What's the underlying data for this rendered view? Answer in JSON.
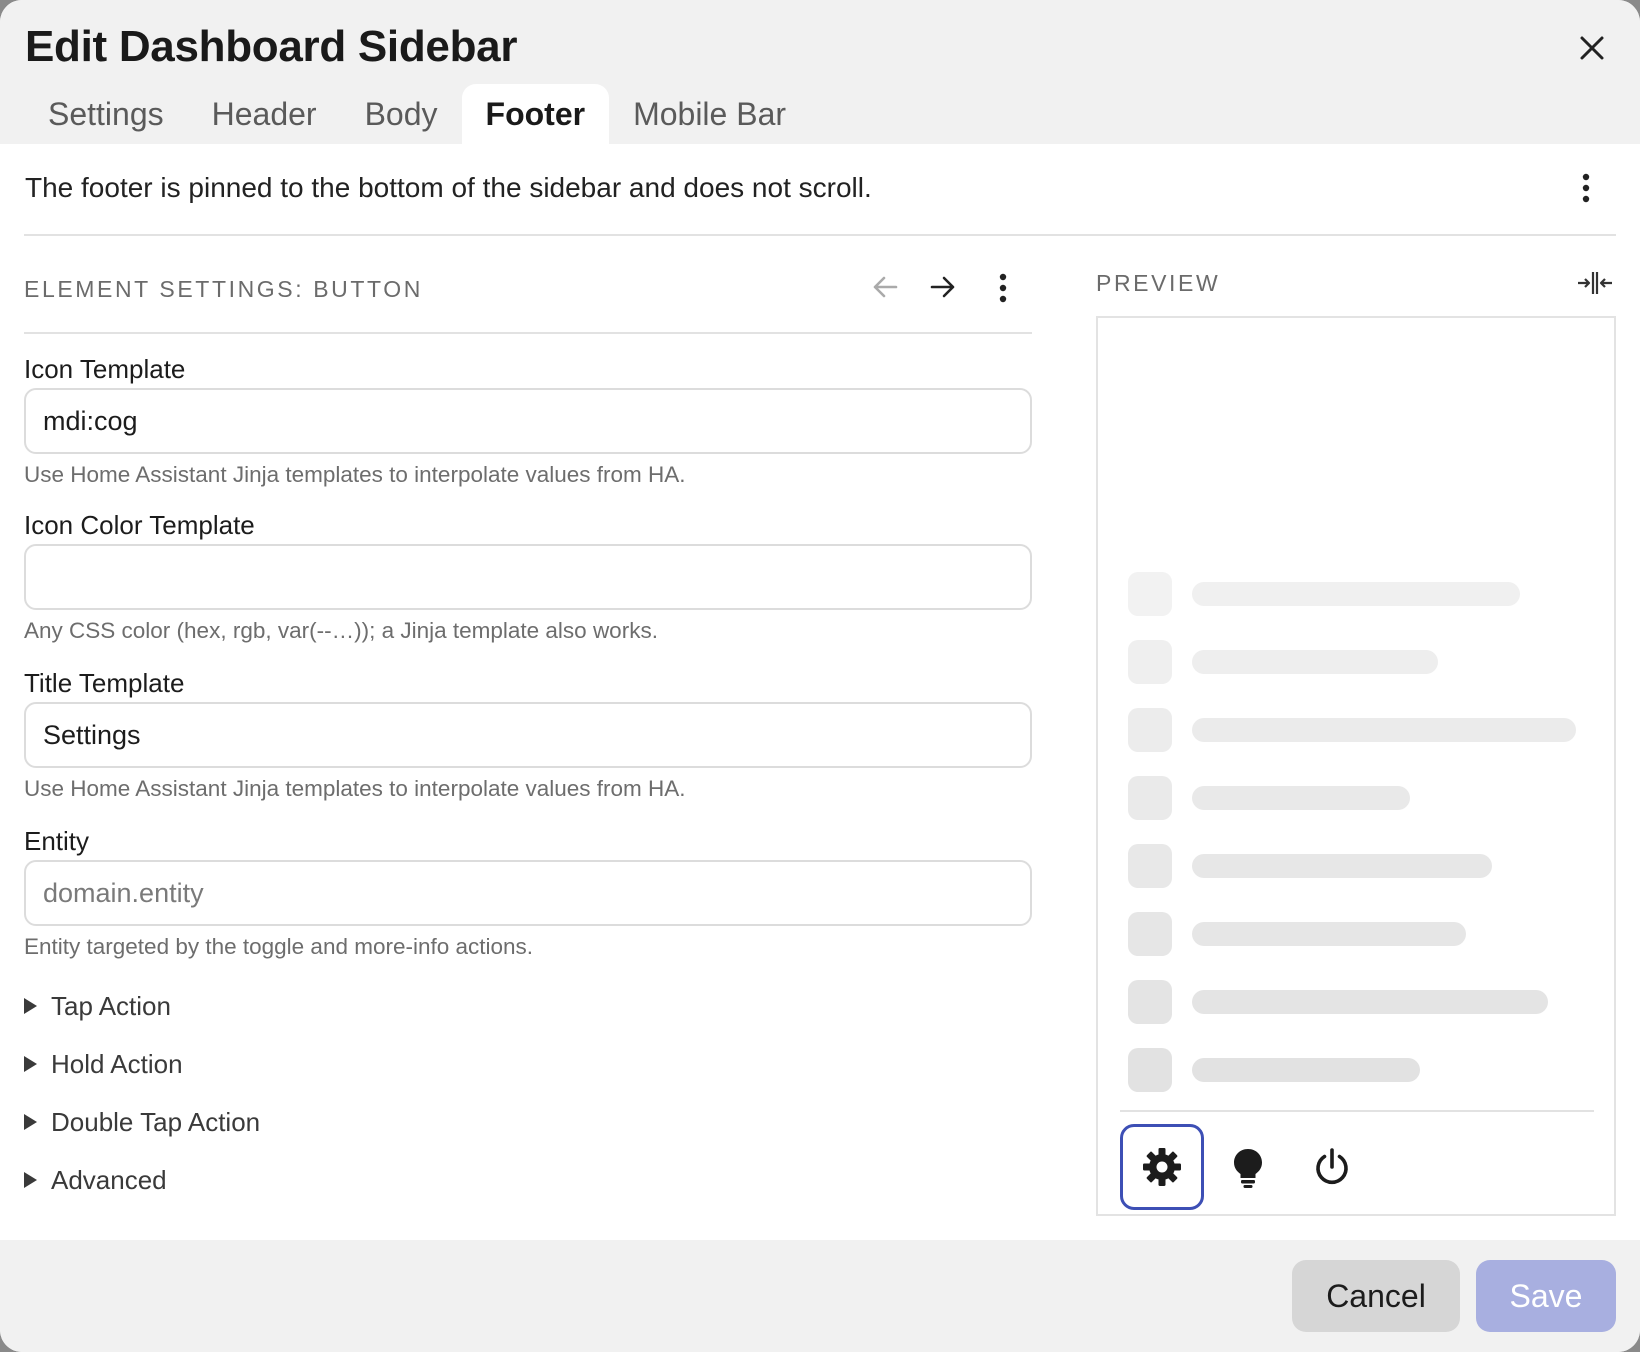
{
  "dialog": {
    "title": "Edit Dashboard Sidebar",
    "tabs": [
      {
        "label": "Settings",
        "active": false
      },
      {
        "label": "Header",
        "active": false
      },
      {
        "label": "Body",
        "active": false
      },
      {
        "label": "Footer",
        "active": true
      },
      {
        "label": "Mobile Bar",
        "active": false
      }
    ],
    "description": "The footer is pinned to the bottom of the sidebar and does not scroll."
  },
  "element_settings": {
    "title": "ELEMENT SETTINGS: BUTTON",
    "fields": {
      "icon_template": {
        "label": "Icon Template",
        "value": "mdi:cog",
        "helper": "Use Home Assistant Jinja templates to interpolate values from HA."
      },
      "icon_color_template": {
        "label": "Icon Color Template",
        "value": "",
        "helper": "Any CSS color (hex, rgb, var(--…)); a Jinja template also works."
      },
      "title_template": {
        "label": "Title Template",
        "value": "Settings",
        "helper": "Use Home Assistant Jinja templates to interpolate values from HA."
      },
      "entity": {
        "label": "Entity",
        "value": "",
        "placeholder": "domain.entity",
        "helper": "Entity targeted by the toggle and more-info actions."
      }
    },
    "accordions": [
      {
        "label": "Tap Action"
      },
      {
        "label": "Hold Action"
      },
      {
        "label": "Double Tap Action"
      },
      {
        "label": "Advanced"
      }
    ]
  },
  "preview": {
    "title": "PREVIEW",
    "skeleton_rows": 8,
    "footer_buttons": [
      {
        "icon": "cog-icon",
        "selected": true
      },
      {
        "icon": "lightbulb-icon",
        "selected": false
      },
      {
        "icon": "power-icon",
        "selected": false
      }
    ]
  },
  "footer": {
    "cancel_label": "Cancel",
    "save_label": "Save"
  },
  "colors": {
    "accent": "#3d4fb5",
    "save_disabled": "#a8afe0",
    "header_bg": "#f1f1f1"
  }
}
